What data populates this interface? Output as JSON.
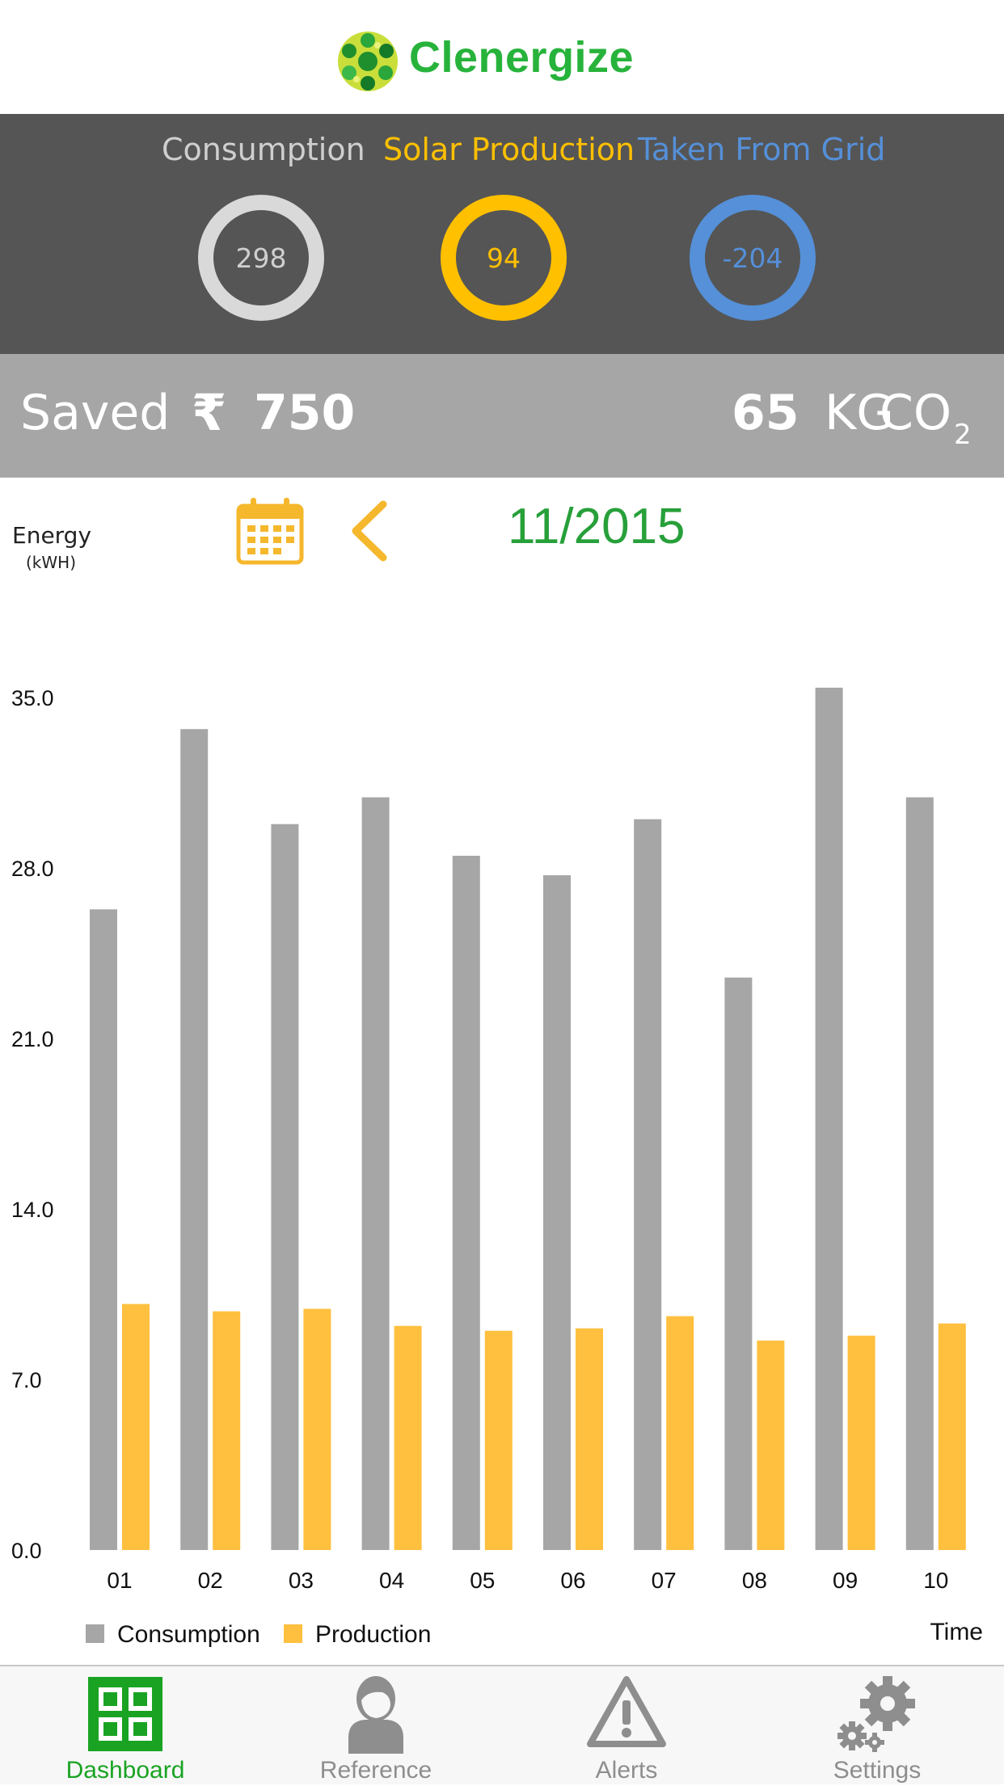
{
  "header": {
    "app_name": "Clenergize"
  },
  "summary": {
    "consumption": {
      "label": "Consumption",
      "value": "298",
      "color": "#d9d9d9"
    },
    "production": {
      "label": "Solar Production",
      "value": "94",
      "color": "#ffc000"
    },
    "grid": {
      "label": "Taken From Grid",
      "value": "-204",
      "color": "#5590d9"
    }
  },
  "savings": {
    "saved_label": "Saved",
    "currency_symbol": "₹",
    "amount": "750",
    "co2_amount": "65",
    "co2_unit": "KG",
    "co2_gas": "CO",
    "co2_subscript": "2"
  },
  "date_bar": {
    "period": "11/2015"
  },
  "chart_data": {
    "type": "bar",
    "ylabel": "Energy",
    "yunit": "(kWH)",
    "xlabel": "Time",
    "categories": [
      "01",
      "02",
      "03",
      "04",
      "05",
      "06",
      "07",
      "08",
      "09",
      "10"
    ],
    "ylim": [
      0,
      35
    ],
    "yticks": [
      "0.0",
      "7.0",
      "14.0",
      "21.0",
      "28.0",
      "35.0"
    ],
    "series": [
      {
        "name": "Consumption",
        "color": "#a6a6a6",
        "values": [
          26.3,
          33.7,
          29.8,
          30.9,
          28.5,
          27.7,
          30.0,
          23.5,
          35.4,
          30.9
        ]
      },
      {
        "name": "Production",
        "color": "#ffc03f",
        "values": [
          10.1,
          9.8,
          9.9,
          9.2,
          9.0,
          9.1,
          9.6,
          8.6,
          8.8,
          9.3
        ]
      }
    ],
    "grid": false,
    "legend": "bottom-left"
  },
  "tabs": [
    {
      "label": "Dashboard",
      "active": true,
      "color": "#1aa323"
    },
    {
      "label": "Reference",
      "active": false,
      "color": "#8e8e8e"
    },
    {
      "label": "Alerts",
      "active": false,
      "color": "#8e8e8e"
    },
    {
      "label": "Settings",
      "active": false,
      "color": "#8e8e8e"
    }
  ]
}
